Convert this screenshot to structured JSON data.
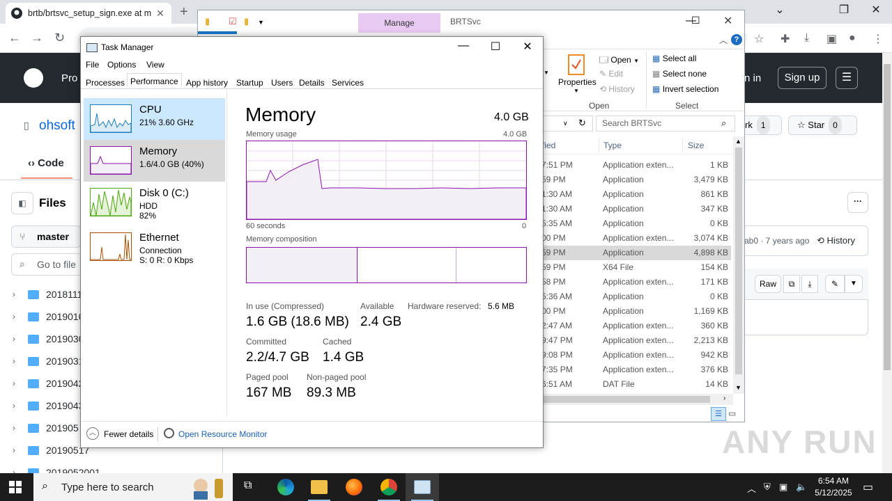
{
  "browser": {
    "tab_title": "brtb/brtsvc_setup_sign.exe at m",
    "tab_close": "✕",
    "new_tab": "+",
    "minimize": "⌄",
    "restore": "❐",
    "close": "✕"
  },
  "github": {
    "product_label": "Pro",
    "sign_in": "n in",
    "sign_up": "Sign up",
    "repo_name": "ohsoft",
    "code_tab": "Code",
    "files_title": "Files",
    "branch": "master",
    "goto_placeholder": "Go to file",
    "fork_label": "rk",
    "fork_count": "1",
    "star_label": "Star",
    "star_count": "0",
    "commit_info": "ab0 · 7 years ago",
    "history": "History",
    "raw": "Raw",
    "tree": [
      "2018111",
      "2019010",
      "2019030",
      "2019031",
      "2019042",
      "2019043",
      "201905",
      "20190517",
      "2019052001"
    ]
  },
  "explorer": {
    "manage_tab": "Manage",
    "title": "BRTSvc",
    "ribbon": {
      "properties": "Properties",
      "open": "Open",
      "edit": "Edit",
      "history": "History",
      "open_group": "Open",
      "select_all": "Select all",
      "select_none": "Select none",
      "invert_selection": "Invert selection",
      "select_group": "Select"
    },
    "search_placeholder": "Search BRTSvc",
    "columns": {
      "modified": "fied",
      "type": "Type",
      "size": "Size"
    },
    "rows": [
      {
        "date": "7:51 PM",
        "type": "Application exten...",
        "size": "1 KB"
      },
      {
        "date": "59 PM",
        "type": "Application",
        "size": "3,479 KB"
      },
      {
        "date": "1:30 AM",
        "type": "Application",
        "size": "861 KB"
      },
      {
        "date": "1:30 AM",
        "type": "Application",
        "size": "347 KB"
      },
      {
        "date": "5:35 AM",
        "type": "Application",
        "size": "0 KB"
      },
      {
        "date": "00 PM",
        "type": "Application exten...",
        "size": "3,074 KB"
      },
      {
        "date": "59 PM",
        "type": "Application",
        "size": "4,898 KB"
      },
      {
        "date": "59 PM",
        "type": "X64 File",
        "size": "154 KB"
      },
      {
        "date": "58 PM",
        "type": "Application exten...",
        "size": "171 KB"
      },
      {
        "date": "5:36 AM",
        "type": "Application",
        "size": "0 KB"
      },
      {
        "date": "00 PM",
        "type": "Application",
        "size": "1,169 KB"
      },
      {
        "date": "2:47 AM",
        "type": "Application exten...",
        "size": "360 KB"
      },
      {
        "date": "9:47 PM",
        "type": "Application exten...",
        "size": "2,213 KB"
      },
      {
        "date": "9:08 PM",
        "type": "Application exten...",
        "size": "942 KB"
      },
      {
        "date": "7:35 PM",
        "type": "Application exten...",
        "size": "376 KB"
      },
      {
        "date": "6:51 AM",
        "type": "DAT File",
        "size": "14 KB"
      }
    ]
  },
  "taskmanager": {
    "title": "Task Manager",
    "menu": [
      "File",
      "Options",
      "View"
    ],
    "tabs": [
      "Processes",
      "Performance",
      "App history",
      "Startup",
      "Users",
      "Details",
      "Services"
    ],
    "resources": [
      {
        "name": "CPU",
        "line1": "21% 3.60 GHz",
        "line2": ""
      },
      {
        "name": "Memory",
        "line1": "1.6/4.0 GB (40%)",
        "line2": ""
      },
      {
        "name": "Disk 0 (C:)",
        "line1": "HDD",
        "line2": "82%"
      },
      {
        "name": "Ethernet",
        "line1": "Connection",
        "line2": "S: 0 R: 0 Kbps"
      }
    ],
    "memory": {
      "title": "Memory",
      "total": "4.0 GB",
      "usage_label": "Memory usage",
      "usage_max": "4.0 GB",
      "time_span": "60 seconds",
      "time_zero": "0",
      "composition_label": "Memory composition",
      "in_use_label": "In use (Compressed)",
      "in_use": "1.6 GB (18.6 MB)",
      "available_label": "Available",
      "available": "2.4 GB",
      "hw_reserved_label": "Hardware reserved:",
      "hw_reserved": "5.6 MB",
      "committed_label": "Committed",
      "committed": "2.2/4.7 GB",
      "cached_label": "Cached",
      "cached": "1.4 GB",
      "paged_label": "Paged pool",
      "paged": "167 MB",
      "nonpaged_label": "Non-paged pool",
      "nonpaged": "89.3 MB"
    },
    "fewer_details": "Fewer details",
    "open_resource_monitor": "Open Resource Monitor"
  },
  "taskbar": {
    "search_placeholder": "Type here to search",
    "time": "6:54 AM",
    "date": "5/12/2025"
  },
  "watermark": "ANY RUN",
  "colors": {
    "memory_accent": "#8b12ae",
    "cpu_accent": "#1b7ebf",
    "disk_accent": "#4da60c",
    "ethernet_accent": "#a74f01"
  }
}
